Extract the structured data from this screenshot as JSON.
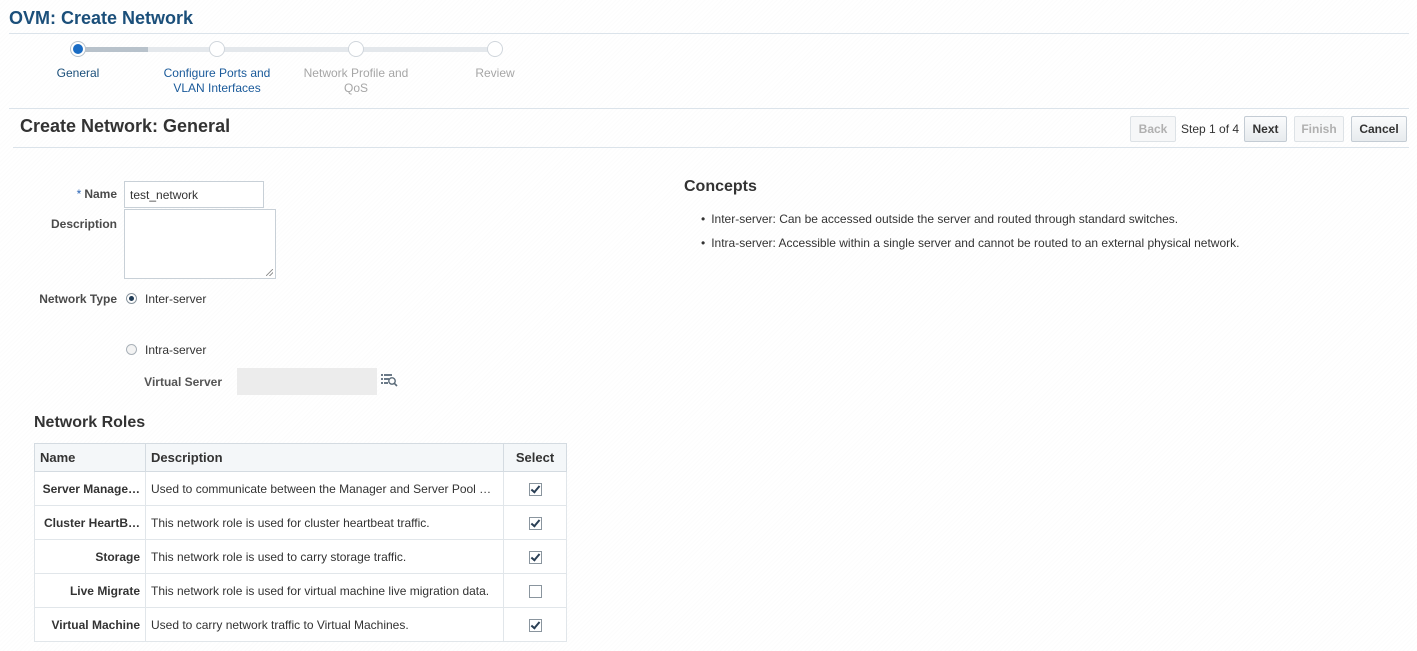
{
  "app": {
    "title": "OVM: Create Network"
  },
  "train": {
    "steps": [
      {
        "label": "General",
        "state": "current"
      },
      {
        "label": "Configure Ports and VLAN Interfaces",
        "state": "link"
      },
      {
        "label": "Network Profile and QoS",
        "state": "disabled"
      },
      {
        "label": "Review",
        "state": "disabled"
      }
    ]
  },
  "header": {
    "title": "Create Network: General",
    "back_label": "Back",
    "step_text": "Step 1 of 4",
    "next_label": "Next",
    "finish_label": "Finish",
    "cancel_label": "Cancel"
  },
  "form": {
    "required_marker": "*",
    "name_label": "Name",
    "name_value": "test_network",
    "description_label": "Description",
    "description_value": "",
    "network_type_label": "Network Type",
    "inter_server_label": "Inter-server",
    "intra_server_label": "Intra-server",
    "selected_type": "Inter-server",
    "virtual_server_label": "Virtual Server",
    "virtual_server_value": "",
    "search_icon": "search-list-icon"
  },
  "concepts": {
    "title": "Concepts",
    "items": [
      "Inter-server: Can be accessed outside the server and routed through standard switches.",
      "Intra-server: Accessible within a single server and cannot be routed to an external physical network."
    ]
  },
  "roles": {
    "title": "Network Roles",
    "columns": [
      "Name",
      "Description",
      "Select"
    ],
    "rows": [
      {
        "name": "Server Manage…",
        "description": "Used to communicate between the Manager and Server Pool …",
        "selected": true
      },
      {
        "name": "Cluster HeartB…",
        "description": "This network role is used for cluster heartbeat traffic.",
        "selected": true
      },
      {
        "name": "Storage",
        "description": "This network role is used to carry storage traffic.",
        "selected": true
      },
      {
        "name": "Live Migrate",
        "description": "This network role is used for virtual machine live migration data.",
        "selected": false
      },
      {
        "name": "Virtual Machine",
        "description": "Used to carry network traffic to Virtual Machines.",
        "selected": true
      }
    ]
  },
  "colors": {
    "title": "#1b4f7a",
    "accent": "#1a6cc4"
  }
}
